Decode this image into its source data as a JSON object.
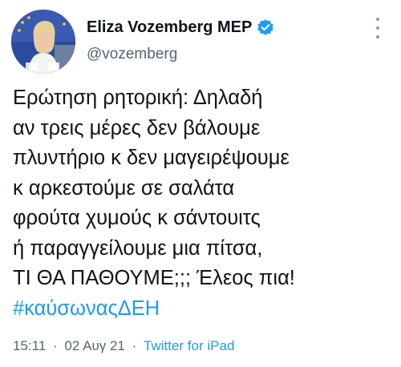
{
  "author": {
    "display_name": "Eliza Vozemberg MEP",
    "handle": "@vozemberg",
    "verified_icon": "verified-badge-icon",
    "avatar_icon": "profile-photo"
  },
  "menu": {
    "icon": "more-vertical-icon"
  },
  "tweet": {
    "lines": [
      "Ερώτηση ρητορική: Δηλαδή",
      "αν τρεις μέρες δεν βάλουμε",
      "πλυντήριο κ δεν μαγειρέψουμε",
      "κ αρκεστούμε σε σαλάτα",
      "φρούτα χυμούς κ σάντουιτς",
      "ή παραγγείλουμε μια πίτσα,",
      "ΤΙ ΘΑ ΠΑΘΟΥΜΕ;;; Έλεος πια!"
    ],
    "hashtag": "#καύσωναςΔΕΗ"
  },
  "meta": {
    "time": "15:11",
    "separator": "·",
    "date": "02 Αυγ 21",
    "source": "Twitter for iPad"
  },
  "colors": {
    "link": "#1d9bf0",
    "secondary_text": "#536471",
    "primary_text": "#0f1419"
  }
}
